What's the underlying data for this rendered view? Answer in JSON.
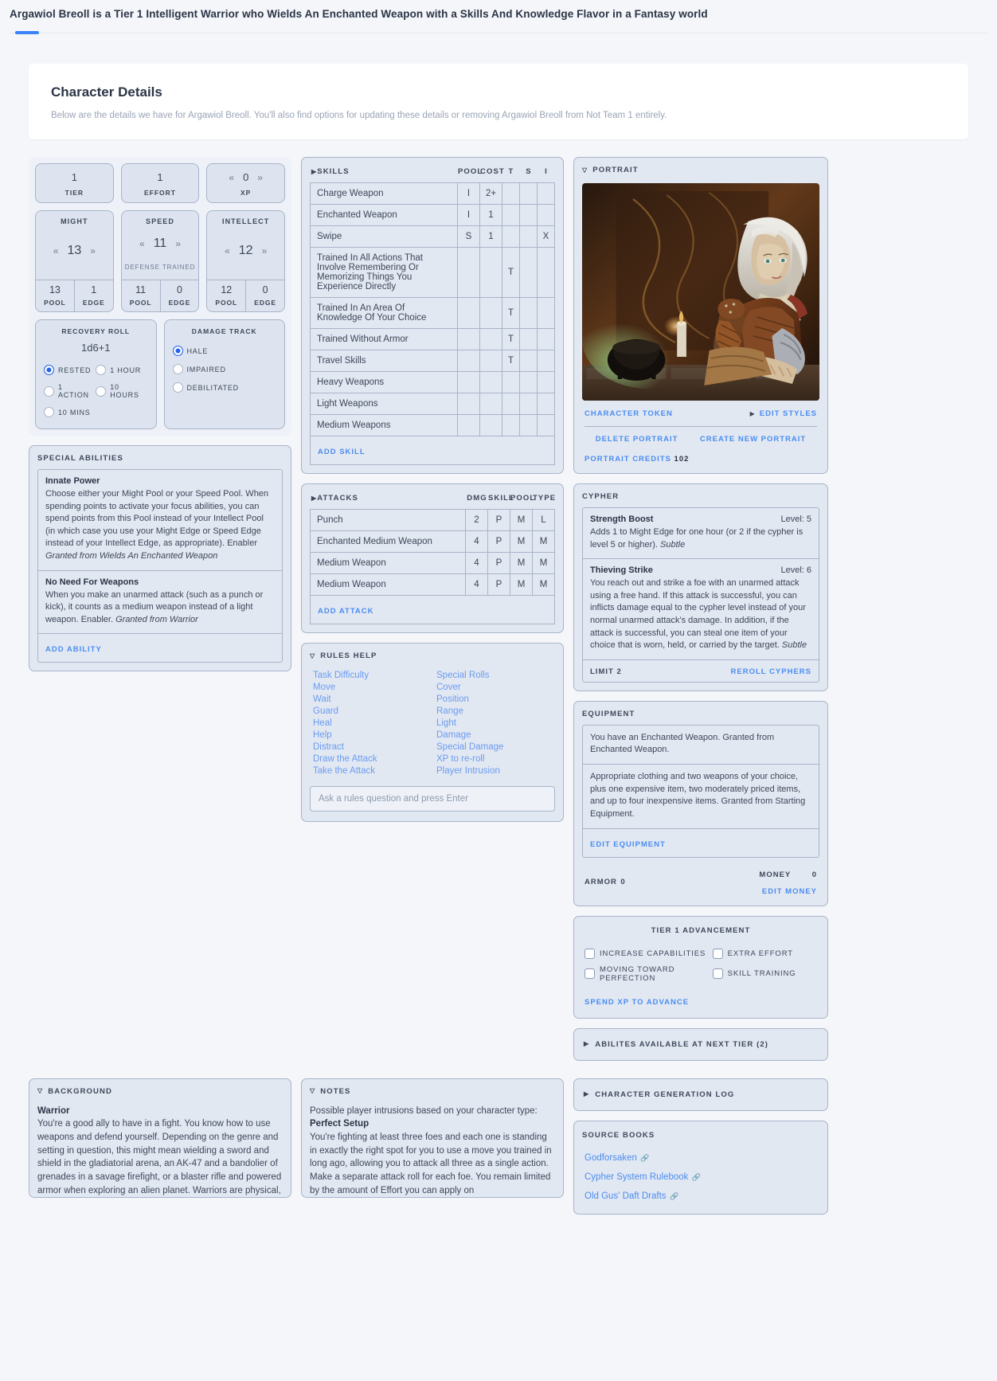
{
  "topbar": {
    "title": "Argawiol Breoll is a Tier 1 Intelligent Warrior who Wields An Enchanted Weapon with a Skills And Knowledge Flavor in a Fantasy world"
  },
  "header": {
    "title": "Character Details",
    "subtitle": "Below are the details we have for Argawiol Breoll. You'll also find options for updating these details or removing Argawiol Breoll from Not Team 1 entirely."
  },
  "stats": {
    "tier": {
      "value": "1",
      "label": "TIER"
    },
    "effort": {
      "value": "1",
      "label": "EFFORT"
    },
    "xp": {
      "value": "0",
      "label": "XP"
    },
    "pools": [
      {
        "name": "MIGHT",
        "value": "13",
        "sub": "",
        "pool": "13",
        "pool_label": "POOL",
        "edge": "1",
        "edge_label": "EDGE"
      },
      {
        "name": "SPEED",
        "value": "11",
        "sub": "DEFENSE TRAINED",
        "pool": "11",
        "pool_label": "POOL",
        "edge": "0",
        "edge_label": "EDGE"
      },
      {
        "name": "INTELLECT",
        "value": "12",
        "sub": "",
        "pool": "12",
        "pool_label": "POOL",
        "edge": "0",
        "edge_label": "EDGE"
      }
    ]
  },
  "recovery": {
    "title": "RECOVERY ROLL",
    "dice": "1d6+1",
    "options": [
      {
        "label": "RESTED",
        "selected": true
      },
      {
        "label": "1 HOUR",
        "selected": false
      },
      {
        "label": "1 ACTION",
        "selected": false
      },
      {
        "label": "10 HOURS",
        "selected": false
      },
      {
        "label": "10 MINS",
        "selected": false
      }
    ]
  },
  "damage_track": {
    "title": "DAMAGE TRACK",
    "options": [
      {
        "label": "HALE",
        "selected": true
      },
      {
        "label": "IMPAIRED",
        "selected": false
      },
      {
        "label": "DEBILITATED",
        "selected": false
      }
    ]
  },
  "special_abilities": {
    "title": "SPECIAL ABILITIES",
    "items": [
      {
        "name": "Innate Power",
        "body": "Choose either your Might Pool or your Speed Pool. When spending points to activate your focus abilities, you can spend points from this Pool instead of your Intellect Pool (in which case you use your Might Edge or Speed Edge instead of your Intellect Edge, as appropriate). Enabler ",
        "granted": "Granted from Wields An Enchanted Weapon"
      },
      {
        "name": "No Need For Weapons",
        "body": "When you make an unarmed attack (such as a punch or kick), it counts as a medium weapon instead of a light weapon. Enabler. ",
        "granted": "Granted from Warrior"
      }
    ],
    "add_label": "ADD ABILITY"
  },
  "skills": {
    "title": "SKILLS",
    "columns": [
      "POOL",
      "COST",
      "T",
      "S",
      "I"
    ],
    "rows": [
      {
        "name": "Charge Weapon",
        "pool": "I",
        "cost": "2+",
        "t": "",
        "s": "",
        "i": ""
      },
      {
        "name": "Enchanted Weapon",
        "pool": "I",
        "cost": "1",
        "t": "",
        "s": "",
        "i": ""
      },
      {
        "name": "Swipe",
        "pool": "S",
        "cost": "1",
        "t": "",
        "s": "",
        "i": "X"
      },
      {
        "name": "Trained In All Actions That Involve Remembering Or Memorizing Things You Experience Directly",
        "pool": "",
        "cost": "",
        "t": "T",
        "s": "",
        "i": ""
      },
      {
        "name": "Trained In An Area Of Knowledge Of Your Choice",
        "pool": "",
        "cost": "",
        "t": "T",
        "s": "",
        "i": ""
      },
      {
        "name": "Trained Without Armor",
        "pool": "",
        "cost": "",
        "t": "T",
        "s": "",
        "i": ""
      },
      {
        "name": "Travel Skills",
        "pool": "",
        "cost": "",
        "t": "T",
        "s": "",
        "i": ""
      },
      {
        "name": "Heavy Weapons",
        "pool": "",
        "cost": "",
        "t": "",
        "s": "",
        "i": ""
      },
      {
        "name": "Light Weapons",
        "pool": "",
        "cost": "",
        "t": "",
        "s": "",
        "i": ""
      },
      {
        "name": "Medium Weapons",
        "pool": "",
        "cost": "",
        "t": "",
        "s": "",
        "i": ""
      }
    ],
    "add_label": "ADD SKILL"
  },
  "attacks": {
    "title": "ATTACKS",
    "columns": [
      "DMG",
      "SKILL",
      "POOL",
      "TYPE"
    ],
    "rows": [
      {
        "name": "Punch",
        "dmg": "2",
        "skill": "P",
        "pool": "M",
        "type": "L"
      },
      {
        "name": "Enchanted Medium Weapon",
        "dmg": "4",
        "skill": "P",
        "pool": "M",
        "type": "M"
      },
      {
        "name": "Medium Weapon",
        "dmg": "4",
        "skill": "P",
        "pool": "M",
        "type": "M"
      },
      {
        "name": "Medium Weapon",
        "dmg": "4",
        "skill": "P",
        "pool": "M",
        "type": "M"
      }
    ],
    "add_label": "ADD ATTACK"
  },
  "rules_help": {
    "title": "RULES HELP",
    "left_links": [
      "Task Difficulty",
      "Move",
      "Wait",
      "Guard",
      "Heal",
      "Help",
      "Distract",
      "Draw the Attack",
      "Take the Attack"
    ],
    "right_links": [
      "Special Rolls",
      "Cover",
      "Position",
      "Range",
      "Light",
      "Damage",
      "Special Damage",
      "XP to re-roll",
      "Player Intrusion"
    ],
    "ask_placeholder": "Ask a rules question and press Enter"
  },
  "portrait": {
    "title": "PORTRAIT",
    "character_token": "CHARACTER TOKEN",
    "edit_styles": "EDIT STYLES",
    "delete": "DELETE PORTRAIT",
    "create_new": "CREATE NEW PORTRAIT",
    "credits_label": "PORTRAIT CREDITS",
    "credits_value": "102"
  },
  "cypher": {
    "title": "CYPHER",
    "items": [
      {
        "name": "Strength Boost",
        "level_label": "Level: 5",
        "body": "Adds 1 to Might Edge for one hour (or 2 if the cypher is level 5 or higher). ",
        "tag": "Subtle"
      },
      {
        "name": "Thieving Strike",
        "level_label": "Level: 6",
        "body": "You reach out and strike a foe with an unarmed attack using a free hand. If this attack is successful, you can inflicts damage equal to the cypher level instead of your normal unarmed attack's damage. In addition, if the attack is successful, you can steal one item of your choice that is worn, held, or carried by the target. ",
        "tag": "Subtle"
      }
    ],
    "limit_label": "LIMIT 2",
    "reroll_label": "REROLL CYPHERS"
  },
  "equipment": {
    "title": "EQUIPMENT",
    "items": [
      "You have an Enchanted Weapon. Granted from Enchanted Weapon.",
      "Appropriate clothing and two weapons of your choice, plus one expensive item, two moderately priced items, and up to four inexpensive items. Granted from Starting Equipment."
    ],
    "edit_label": "EDIT EQUIPMENT",
    "armor_label": "ARMOR",
    "armor_value": "0",
    "money_label": "MONEY",
    "money_value": "0",
    "edit_money_label": "EDIT MONEY"
  },
  "advancement": {
    "title": "TIER 1 ADVANCEMENT",
    "options": [
      {
        "label": "INCREASE CAPABILITIES",
        "checked": false
      },
      {
        "label": "EXTRA EFFORT",
        "checked": false
      },
      {
        "label": "MOVING TOWARD PERFECTION",
        "checked": false
      },
      {
        "label": "SKILL TRAINING",
        "checked": false
      }
    ],
    "spend_label": "SPEND XP TO ADVANCE"
  },
  "next_tier_bar": {
    "label": "ABILITES AVAILABLE AT NEXT TIER (2)"
  },
  "char_gen_log_bar": {
    "label": "CHARACTER GENERATION LOG"
  },
  "source_books": {
    "title": "SOURCE BOOKS",
    "links": [
      "Godforsaken",
      "Cypher System Rulebook",
      "Old Gus' Daft Drafts"
    ]
  },
  "background": {
    "title": "BACKGROUND",
    "heading": "Warrior",
    "body": "You're a good ally to have in a fight. You know how to use weapons and defend yourself. Depending on the genre and setting in question, this might mean wielding a sword and shield in the gladiatorial arena, an AK-47 and a bandolier of grenades in a savage firefight, or a blaster rifle and powered armor when exploring an alien planet. Warriors are physical, action-oriented"
  },
  "notes": {
    "title": "NOTES",
    "intro": "Possible player intrusions based on your character type:",
    "heading": "Perfect Setup",
    "body": "You're fighting at least three foes and each one is standing in exactly the right spot for you to use a move you trained in long ago, allowing you to attack all three as a single action. Make a separate attack roll for each foe. You remain limited by the amount of Effort you can apply on"
  }
}
